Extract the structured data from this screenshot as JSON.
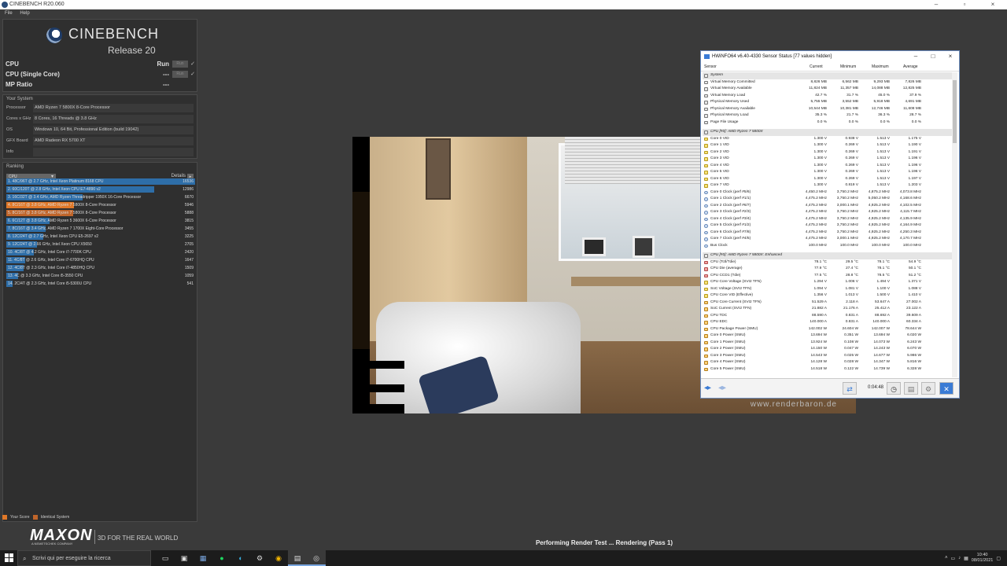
{
  "window": {
    "title": "CINEBENCH R20.060",
    "menu": [
      "File",
      "Help"
    ]
  },
  "logo": {
    "brand": "CINEBENCH",
    "release": "Release 20"
  },
  "bench": [
    {
      "label": "CPU",
      "value": "Run",
      "button": "Run",
      "check": "✓"
    },
    {
      "label": "CPU (Single Core)",
      "value": "---",
      "button": "Run",
      "check": "✓"
    },
    {
      "label": "MP Ratio",
      "value": "---",
      "button": "",
      "check": ""
    }
  ],
  "system": {
    "title": "Your System",
    "rows": [
      {
        "k": "Processor",
        "v": "AMD Ryzen 7 5800X 8-Core Processor"
      },
      {
        "k": "Cores x GHz",
        "v": "8 Cores, 16 Threads @ 3.8 GHz"
      },
      {
        "k": "OS",
        "v": "Windows 10, 64 Bit, Professional Edition (build 19042)"
      },
      {
        "k": "GFX Board",
        "v": "AMD Radeon RX 5700 XT"
      },
      {
        "k": "Info",
        "v": ""
      }
    ]
  },
  "ranking": {
    "title": "Ranking",
    "select": "CPU",
    "details": "Details",
    "max": 16536,
    "items": [
      {
        "label": "1. 48C/96T @ 2.7 GHz, Intel Xeon Platinum 8168 CPU",
        "score": 16536,
        "kind": "other"
      },
      {
        "label": "2. 60C/120T @ 2.8 GHz, Intel Xeon CPU E7-4890 v2",
        "score": 12986,
        "kind": "other"
      },
      {
        "label": "3. 16C/32T @ 3.4 GHz, AMD Ryzen Threadripper 1950X 16-Core Processor",
        "score": 6670,
        "kind": "other"
      },
      {
        "label": "4. 8C/16T @ 3.8 GHz, AMD Ryzen 7 5800X 8-Core Processor",
        "score": 5946,
        "kind": "mine"
      },
      {
        "label": "5. 8C/16T @ 3.8 GHz, AMD Ryzen 7 5800X 8-Core Processor",
        "score": 5888,
        "kind": "ident"
      },
      {
        "label": "6. 6C/12T @ 3.8 GHz, AMD Ryzen 5 3600X 6-Core Processor",
        "score": 3815,
        "kind": "other"
      },
      {
        "label": "7. 8C/16T @ 3.4 GHz, AMD Ryzen 7 1700X Eight-Core Processor",
        "score": 3455,
        "kind": "other"
      },
      {
        "label": "8. 12C/24T @ 2.7 GHz, Intel Xeon CPU E5-2697 v2",
        "score": 3225,
        "kind": "other"
      },
      {
        "label": "9. 12C/24T @ 2.66 GHz, Intel Xeon CPU X5650",
        "score": 2705,
        "kind": "other"
      },
      {
        "label": "10. 4C/8T @ 4.2 GHz, Intel Core i7-7700K CPU",
        "score": 2420,
        "kind": "other"
      },
      {
        "label": "11. 4C/8T @ 2.6 GHz, Intel Core i7-6700HQ CPU",
        "score": 1647,
        "kind": "other"
      },
      {
        "label": "12. 4C/8T @ 2.3 GHz, Intel Core i7-4850HQ CPU",
        "score": 1509,
        "kind": "other"
      },
      {
        "label": "13. 4C @ 3.3 GHz, Intel Core i5-3550 CPU",
        "score": 1059,
        "kind": "other"
      },
      {
        "label": "14. 2C/4T @ 2.3 GHz, Intel Core i5-5300U CPU",
        "score": 541,
        "kind": "other"
      }
    ]
  },
  "legend": {
    "your_score": "Your Score",
    "identical": "Identical System",
    "colors": {
      "mine": "#e07828",
      "ident": "#c0652a",
      "other": "#2e6ea8"
    }
  },
  "maxon": {
    "word": "MAXON",
    "sub": "A NEMETSCHEK COMPANY",
    "tag": "3D FOR THE REAL WORLD"
  },
  "render": {
    "watermark": "www.renderbaron.de"
  },
  "status": "Performing Render Test ... Rendering (Pass 1)",
  "hwinfo": {
    "title": "HWiNFO64 v6.40-4330 Sensor Status [77 values hidden]",
    "headers": {
      "sensor": "Sensor",
      "current": "Current",
      "minimum": "Minimum",
      "maximum": "Maximum",
      "average": "Average"
    },
    "time": "0:04:48",
    "rows": [
      {
        "t": "group",
        "n": "System"
      },
      {
        "t": "mem",
        "n": "Virtual Memory Committed",
        "v": [
          "8,826 MB",
          "6,562 MB",
          "9,293 MB",
          "7,826 MB"
        ]
      },
      {
        "t": "mem",
        "n": "Virtual Memory Available",
        "v": [
          "11,824 MB",
          "11,357 MB",
          "14,088 MB",
          "12,825 MB"
        ]
      },
      {
        "t": "mem",
        "n": "Virtual Memory Load",
        "v": [
          "42.7 %",
          "31.7 %",
          "45.0 %",
          "37.9 %"
        ]
      },
      {
        "t": "mem",
        "n": "Physical Memory Used",
        "v": [
          "5,755 MB",
          "3,552 MB",
          "5,918 MB",
          "4,691 MB"
        ]
      },
      {
        "t": "mem",
        "n": "Physical Memory Available",
        "v": [
          "10,544 MB",
          "10,381 MB",
          "12,746 MB",
          "11,608 MB"
        ]
      },
      {
        "t": "mem",
        "n": "Physical Memory Load",
        "v": [
          "35.3 %",
          "21.7 %",
          "36.3 %",
          "28.7 %"
        ]
      },
      {
        "t": "mem",
        "n": "Page File Usage",
        "v": [
          "0.0 %",
          "0.0 %",
          "0.0 %",
          "0.0 %"
        ]
      },
      {
        "t": "gap"
      },
      {
        "t": "group",
        "n": "CPU [#0]: AMD Ryzen 7 5800X"
      },
      {
        "t": "volt",
        "n": "Core 0 VID",
        "v": [
          "1.300 V",
          "0.938 V",
          "1.513 V",
          "1.175 V"
        ]
      },
      {
        "t": "volt",
        "n": "Core 1 VID",
        "v": [
          "1.300 V",
          "0.269 V",
          "1.513 V",
          "1.190 V"
        ]
      },
      {
        "t": "volt",
        "n": "Core 2 VID",
        "v": [
          "1.300 V",
          "0.269 V",
          "1.513 V",
          "1.191 V"
        ]
      },
      {
        "t": "volt",
        "n": "Core 3 VID",
        "v": [
          "1.300 V",
          "0.269 V",
          "1.513 V",
          "1.196 V"
        ]
      },
      {
        "t": "volt",
        "n": "Core 4 VID",
        "v": [
          "1.300 V",
          "0.269 V",
          "1.513 V",
          "1.196 V"
        ]
      },
      {
        "t": "volt",
        "n": "Core 5 VID",
        "v": [
          "1.300 V",
          "0.269 V",
          "1.513 V",
          "1.196 V"
        ]
      },
      {
        "t": "volt",
        "n": "Core 6 VID",
        "v": [
          "1.300 V",
          "0.269 V",
          "1.513 V",
          "1.197 V"
        ]
      },
      {
        "t": "volt",
        "n": "Core 7 VID",
        "v": [
          "1.300 V",
          "0.819 V",
          "1.513 V",
          "1.203 V"
        ]
      },
      {
        "t": "clk",
        "n": "Core 0 Clock (perf #5/6)",
        "v": [
          "4,450.2 MHz",
          "3,750.2 MHz",
          "4,875.2 MHz",
          "4,073.8 MHz"
        ]
      },
      {
        "t": "clk",
        "n": "Core 1 Clock (perf #1/1)",
        "v": [
          "4,475.2 MHz",
          "3,750.2 MHz",
          "5,050.2 MHz",
          "4,168.6 MHz"
        ]
      },
      {
        "t": "clk",
        "n": "Core 2 Clock (perf #6/7)",
        "v": [
          "4,475.2 MHz",
          "3,000.1 MHz",
          "4,925.2 MHz",
          "4,102.5 MHz"
        ]
      },
      {
        "t": "clk",
        "n": "Core 3 Clock (perf #2/3)",
        "v": [
          "4,475.2 MHz",
          "3,750.2 MHz",
          "4,925.2 MHz",
          "4,115.7 MHz"
        ]
      },
      {
        "t": "clk",
        "n": "Core 4 Clock (perf #3/4)",
        "v": [
          "4,475.2 MHz",
          "3,750.2 MHz",
          "4,925.2 MHz",
          "4,135.9 MHz"
        ]
      },
      {
        "t": "clk",
        "n": "Core 5 Clock (perf #1/2)",
        "v": [
          "4,475.2 MHz",
          "3,750.2 MHz",
          "4,925.2 MHz",
          "4,164.9 MHz"
        ]
      },
      {
        "t": "clk",
        "n": "Core 6 Clock (perf #7/8)",
        "v": [
          "4,475.2 MHz",
          "3,750.2 MHz",
          "4,925.2 MHz",
          "4,250.3 MHz"
        ]
      },
      {
        "t": "clk",
        "n": "Core 7 Clock (perf #4/5)",
        "v": [
          "4,475.2 MHz",
          "3,000.1 MHz",
          "4,925.2 MHz",
          "4,170.7 MHz"
        ]
      },
      {
        "t": "clk",
        "n": "Bus Clock",
        "v": [
          "100.0 MHz",
          "100.0 MHz",
          "100.0 MHz",
          "100.0 MHz"
        ]
      },
      {
        "t": "gap"
      },
      {
        "t": "group",
        "n": "CPU [#0]: AMD Ryzen 7 5800X: Enhanced"
      },
      {
        "t": "temp",
        "n": "CPU (Tctl/Tdie)",
        "v": [
          "78.1 °C",
          "29.5 °C",
          "78.1 °C",
          "54.9 °C"
        ]
      },
      {
        "t": "temp",
        "n": "CPU Die (average)",
        "v": [
          "77.9 °C",
          "27.4 °C",
          "78.1 °C",
          "50.1 °C"
        ]
      },
      {
        "t": "temp",
        "n": "CPU CCD1 (Tdie)",
        "v": [
          "77.5 °C",
          "28.8 °C",
          "78.5 °C",
          "51.2 °C"
        ]
      },
      {
        "t": "volt",
        "n": "CPU Core Voltage (SVI2 TFN)",
        "v": [
          "1.294 V",
          "1.006 V",
          "1.494 V",
          "1.371 V"
        ]
      },
      {
        "t": "volt",
        "n": "SoC Voltage (SVI2 TFN)",
        "v": [
          "1.094 V",
          "1.081 V",
          "1.100 V",
          "1.088 V"
        ]
      },
      {
        "t": "volt",
        "n": "CPU Core VID (Effective)",
        "v": [
          "1.356 V",
          "1.013 V",
          "1.500 V",
          "1.410 V"
        ]
      },
      {
        "t": "pwr",
        "n": "CPU Core Current (SVI2 TFN)",
        "v": [
          "51.529 A",
          "2.118 A",
          "53.647 A",
          "27.002 A"
        ]
      },
      {
        "t": "pwr",
        "n": "SoC Current (SVI2 TFN)",
        "v": [
          "21.882 A",
          "21.176 A",
          "25.412 A",
          "23.122 A"
        ]
      },
      {
        "t": "pwr",
        "n": "CPU TDC",
        "v": [
          "88.590 A",
          "0.831 A",
          "88.692 A",
          "39.609 A"
        ]
      },
      {
        "t": "pwr",
        "n": "CPU EDC",
        "v": [
          "140.000 A",
          "0.831 A",
          "140.000 A",
          "60.334 A"
        ]
      },
      {
        "t": "pwr",
        "n": "CPU Package Power (SMU)",
        "v": [
          "142.002 W",
          "24.604 W",
          "142.007 W",
          "78.644 W"
        ]
      },
      {
        "t": "pwr",
        "n": "Core 0 Power (SMU)",
        "v": [
          "13.694 W",
          "0.351 W",
          "13.694 W",
          "6.020 W"
        ]
      },
      {
        "t": "pwr",
        "n": "Core 1 Power (SMU)",
        "v": [
          "13.924 W",
          "0.108 W",
          "14.073 W",
          "6.243 W"
        ]
      },
      {
        "t": "pwr",
        "n": "Core 2 Power (SMU)",
        "v": [
          "14.150 W",
          "0.047 W",
          "14.243 W",
          "6.070 W"
        ]
      },
      {
        "t": "pwr",
        "n": "Core 3 Power (SMU)",
        "v": [
          "14.543 W",
          "0.025 W",
          "14.677 W",
          "5.986 W"
        ]
      },
      {
        "t": "pwr",
        "n": "Core 4 Power (SMU)",
        "v": [
          "14.128 W",
          "0.028 W",
          "14.347 W",
          "5.816 W"
        ]
      },
      {
        "t": "pwr",
        "n": "Core 5 Power (SMU)",
        "v": [
          "14.518 W",
          "0.122 W",
          "14.739 W",
          "6.328 W"
        ]
      }
    ]
  },
  "taskbar": {
    "search_placeholder": "Scrivi qui per eseguire la ricerca",
    "time": "10:40",
    "date": "08/01/2021"
  }
}
